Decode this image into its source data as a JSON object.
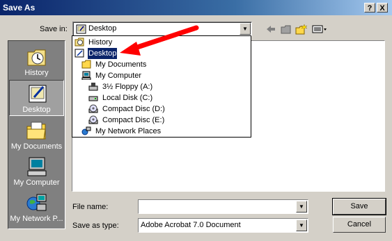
{
  "window": {
    "title": "Save As"
  },
  "title_buttons": {
    "help": "?",
    "close": "X"
  },
  "save_in": {
    "label": "Save in:",
    "value": "Desktop",
    "options": [
      {
        "label": "History",
        "icon": "history-icon"
      },
      {
        "label": "Desktop",
        "icon": "desktop-icon",
        "selected": true
      },
      {
        "label": "My Documents",
        "icon": "folder-icon"
      },
      {
        "label": "My Computer",
        "icon": "computer-icon"
      },
      {
        "label": "3½ Floppy (A:)",
        "icon": "floppy-icon"
      },
      {
        "label": "Local Disk (C:)",
        "icon": "harddisk-icon"
      },
      {
        "label": "Compact Disc (D:)",
        "icon": "cd-icon"
      },
      {
        "label": "Compact Disc (E:)",
        "icon": "cd-icon"
      },
      {
        "label": "My Network Places",
        "icon": "network-icon"
      }
    ]
  },
  "places": [
    {
      "label": "History",
      "icon": "history-icon"
    },
    {
      "label": "Desktop",
      "icon": "desktop-icon",
      "selected": true
    },
    {
      "label": "My Documents",
      "icon": "folder-icon"
    },
    {
      "label": "My Computer",
      "icon": "computer-icon"
    },
    {
      "label": "My Network P...",
      "icon": "network-icon"
    }
  ],
  "file_name": {
    "label": "File name:",
    "value": ""
  },
  "save_as_type": {
    "label": "Save as type:",
    "value": "Adobe Acrobat 7.0 Document"
  },
  "buttons": {
    "save": "Save",
    "cancel": "Cancel"
  },
  "colors": {
    "titlebar": "#0a246a",
    "selection": "#0a246a",
    "arrow": "#ff0000"
  }
}
